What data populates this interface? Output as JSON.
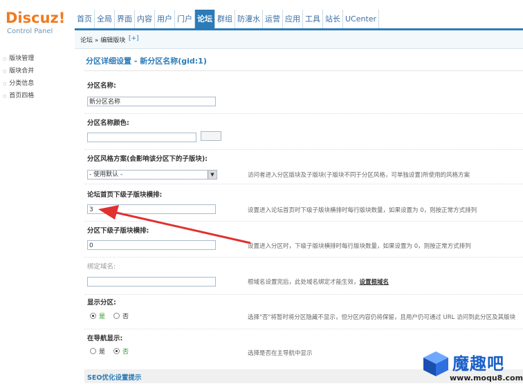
{
  "logo": {
    "brand": "Discuz!",
    "sub": "Control Panel"
  },
  "nav": [
    {
      "label": "首页"
    },
    {
      "label": "全局"
    },
    {
      "label": "界面"
    },
    {
      "label": "内容"
    },
    {
      "label": "用户"
    },
    {
      "label": "门户"
    },
    {
      "label": "论坛",
      "active": true
    },
    {
      "label": "群组"
    },
    {
      "label": "防灌水"
    },
    {
      "label": "运营"
    },
    {
      "label": "应用"
    },
    {
      "label": "工具"
    },
    {
      "label": "站长"
    },
    {
      "label": "UCenter"
    }
  ],
  "breadcrumb": {
    "path": "论坛 » 编辑版块",
    "add": "[+]"
  },
  "sidebar": [
    {
      "label": "版块管理"
    },
    {
      "label": "版块合并"
    },
    {
      "label": "分类信息"
    },
    {
      "label": "首页四格"
    }
  ],
  "form": {
    "title": "分区详细设置 - 新分区名称(gid:1)",
    "name_label": "分区名称:",
    "name_value": "新分区名称",
    "color_label": "分区名称颜色:",
    "style_label": "分区风格方案(会影响该分区下的子版块):",
    "style_value": "- 使用默认 -",
    "style_hint": "访问者进入分区版块及子版块(子版块不同于分区风格，可单独设置)所使用的风格方案",
    "index_cols_label": "论坛首页下级子版块横排:",
    "index_cols_value": "3",
    "index_cols_hint": "设置进入论坛首页时下级子版块横排时每行版块数量，如果设置为 0，则按正常方式排列",
    "sub_cols_label": "分区下级子版块横排:",
    "sub_cols_value": "0",
    "sub_cols_hint": "设置进入分区时，下级子版块横排时每行版块数量，如果设置为 0，则按正常方式排列",
    "domain_label": "绑定域名:",
    "domain_hint": "根域名设置完后，此处域名绑定才能生效，",
    "domain_link": "设置根域名",
    "show_label": "显示分区:",
    "show_yes": "是",
    "show_no": "否",
    "show_hint": "选择\"否\"将暂时将分区隐藏不显示，但分区内容仍将保留，且用户仍可通过 URL 访问到此分区及其版块",
    "nav_label": "在导航显示:",
    "nav_yes": "是",
    "nav_no": "否",
    "nav_hint": "选择是否在主导航中显示",
    "seo_title": "SEO优化设置提示"
  },
  "watermark": {
    "cn": "魔趣吧",
    "url": "www.moqu8.com"
  },
  "colors": {
    "accent": "#2b7bb7",
    "arrow": "#e03030",
    "logo": "#f07a1f"
  }
}
